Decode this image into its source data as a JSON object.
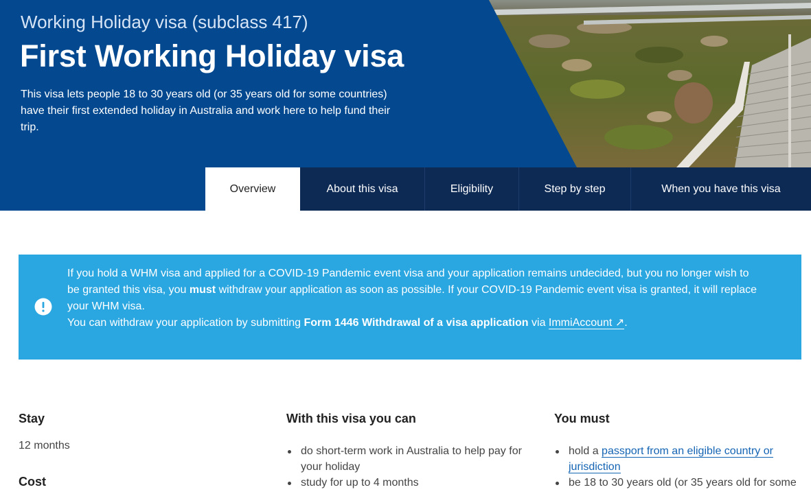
{
  "hero": {
    "subtitle": "Working Holiday visa (subclass 417)",
    "title": "First Working Holiday visa",
    "description": "This visa lets people 18 to 30 years old (or 35 years old for some countries) have their first extended holiday in Australia and work here to help fund their trip.",
    "bg_color": "#04498f"
  },
  "tabs": [
    {
      "label": "Overview",
      "active": true
    },
    {
      "label": "About this visa",
      "active": false
    },
    {
      "label": "Eligibility",
      "active": false
    },
    {
      "label": "Step by step",
      "active": false
    },
    {
      "label": "When you have this visa",
      "active": false
    }
  ],
  "alert": {
    "icon": "info-icon",
    "p1_before": "If you hold a WHM visa and applied for a COVID-19 Pandemic event visa and your application remains undecided, but you no longer wish to be granted this visa, you ",
    "p1_bold": "must",
    "p1_after": " withdraw your application as soon as possible. If your COVID-19 Pandemic event visa is granted, it will replace your WHM visa.",
    "p2_before": "You can withdraw your application by submitting ",
    "p2_bold": "Form 1446 Withdrawal of a visa application",
    "p2_mid": " via ",
    "p2_link": "ImmiAccount",
    "p2_link_icon": "↗",
    "p2_after": ".",
    "bg_color": "#2aa6e0"
  },
  "columns": {
    "stay": {
      "heading": "Stay",
      "value": "12 months"
    },
    "cost": {
      "heading": "Cost"
    },
    "can": {
      "heading": "With this visa you can",
      "items": [
        "do short-term work in Australia to help pay for your holiday",
        "study for up to 4 months"
      ]
    },
    "must": {
      "heading": "You must",
      "item1_before": "hold a ",
      "item1_link": "passport from an eligible country or jurisdiction",
      "item2": "be 18 to 30 years old (or 35 years old for some"
    }
  }
}
